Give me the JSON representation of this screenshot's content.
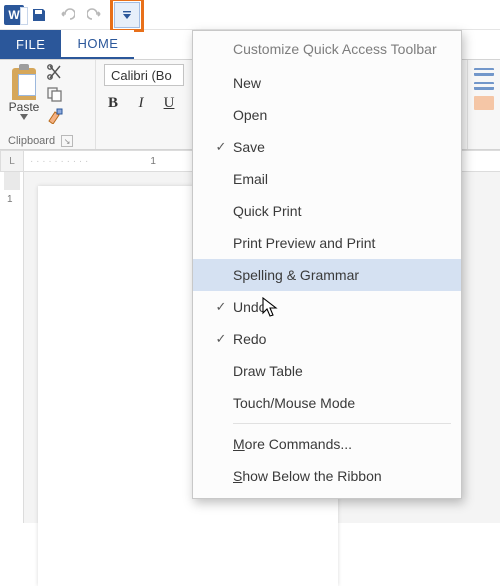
{
  "qat": {
    "word_logo_letter": "W"
  },
  "tabs": {
    "file": "FILE",
    "home": "HOME"
  },
  "clipboard": {
    "paste": "Paste",
    "group": "Clipboard"
  },
  "font": {
    "name_combo": "Calibri (Bo",
    "bold": "B",
    "italic": "I",
    "underline": "U"
  },
  "ruler": {
    "h1": "1",
    "v1": "1",
    "corner": "L"
  },
  "menu": {
    "title": "Customize Quick Access Toolbar",
    "items": [
      {
        "label": "New",
        "checked": false
      },
      {
        "label": "Open",
        "checked": false
      },
      {
        "label": "Save",
        "checked": true
      },
      {
        "label": "Email",
        "checked": false
      },
      {
        "label": "Quick Print",
        "checked": false
      },
      {
        "label": "Print Preview and Print",
        "checked": false
      },
      {
        "label": "Spelling & Grammar",
        "checked": false,
        "hover": true
      },
      {
        "label": "Undo",
        "checked": true
      },
      {
        "label": "Redo",
        "checked": true
      },
      {
        "label": "Draw Table",
        "checked": false
      },
      {
        "label": "Touch/Mouse Mode",
        "checked": false
      }
    ],
    "more_pre": "M",
    "more_post": "ore Commands...",
    "show_pre": "S",
    "show_post": "how Below the Ribbon"
  }
}
